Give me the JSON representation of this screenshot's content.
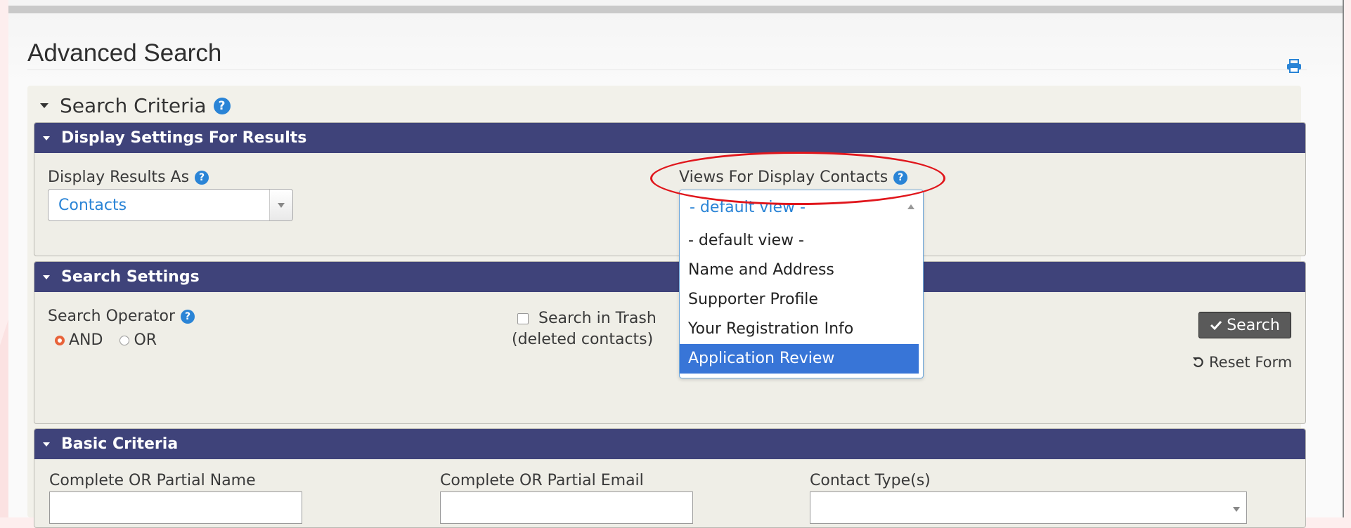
{
  "page": {
    "title": "Advanced Search"
  },
  "search_criteria": {
    "label": "Search Criteria"
  },
  "display_settings": {
    "header": "Display Settings For Results",
    "display_results_label": "Display Results As",
    "display_results_value": "Contacts",
    "views_label": "Views For Display Contacts",
    "views_value": "- default view -",
    "views_options": [
      "- default view -",
      "Name and Address",
      "Supporter Profile",
      "Your Registration Info",
      "Application Review"
    ],
    "views_highlighted": "Application Review"
  },
  "search_settings": {
    "header": "Search Settings",
    "operator_label": "Search Operator",
    "operator_options": [
      "AND",
      "OR"
    ],
    "operator_selected": "AND",
    "trash_label_1": "Search in Trash",
    "trash_label_2": "(deleted contacts)",
    "trash_checked": false,
    "search_button": "Search",
    "reset_link": "Reset Form"
  },
  "basic_criteria": {
    "header": "Basic Criteria",
    "name_label": "Complete OR Partial Name",
    "name_value": "",
    "email_label": "Complete OR Partial Email",
    "email_value": "",
    "contact_type_label": "Contact Type(s)",
    "contact_type_value": ""
  },
  "colors": {
    "panel_header": "#3f437a",
    "link_blue": "#2a84d6",
    "highlight": "#3875d7",
    "annotation": "#e0161c",
    "radio_on": "#e8633a"
  },
  "icons": [
    "print-icon",
    "help-icon",
    "check-icon",
    "reset-icon",
    "collapse-triangle-icon"
  ]
}
